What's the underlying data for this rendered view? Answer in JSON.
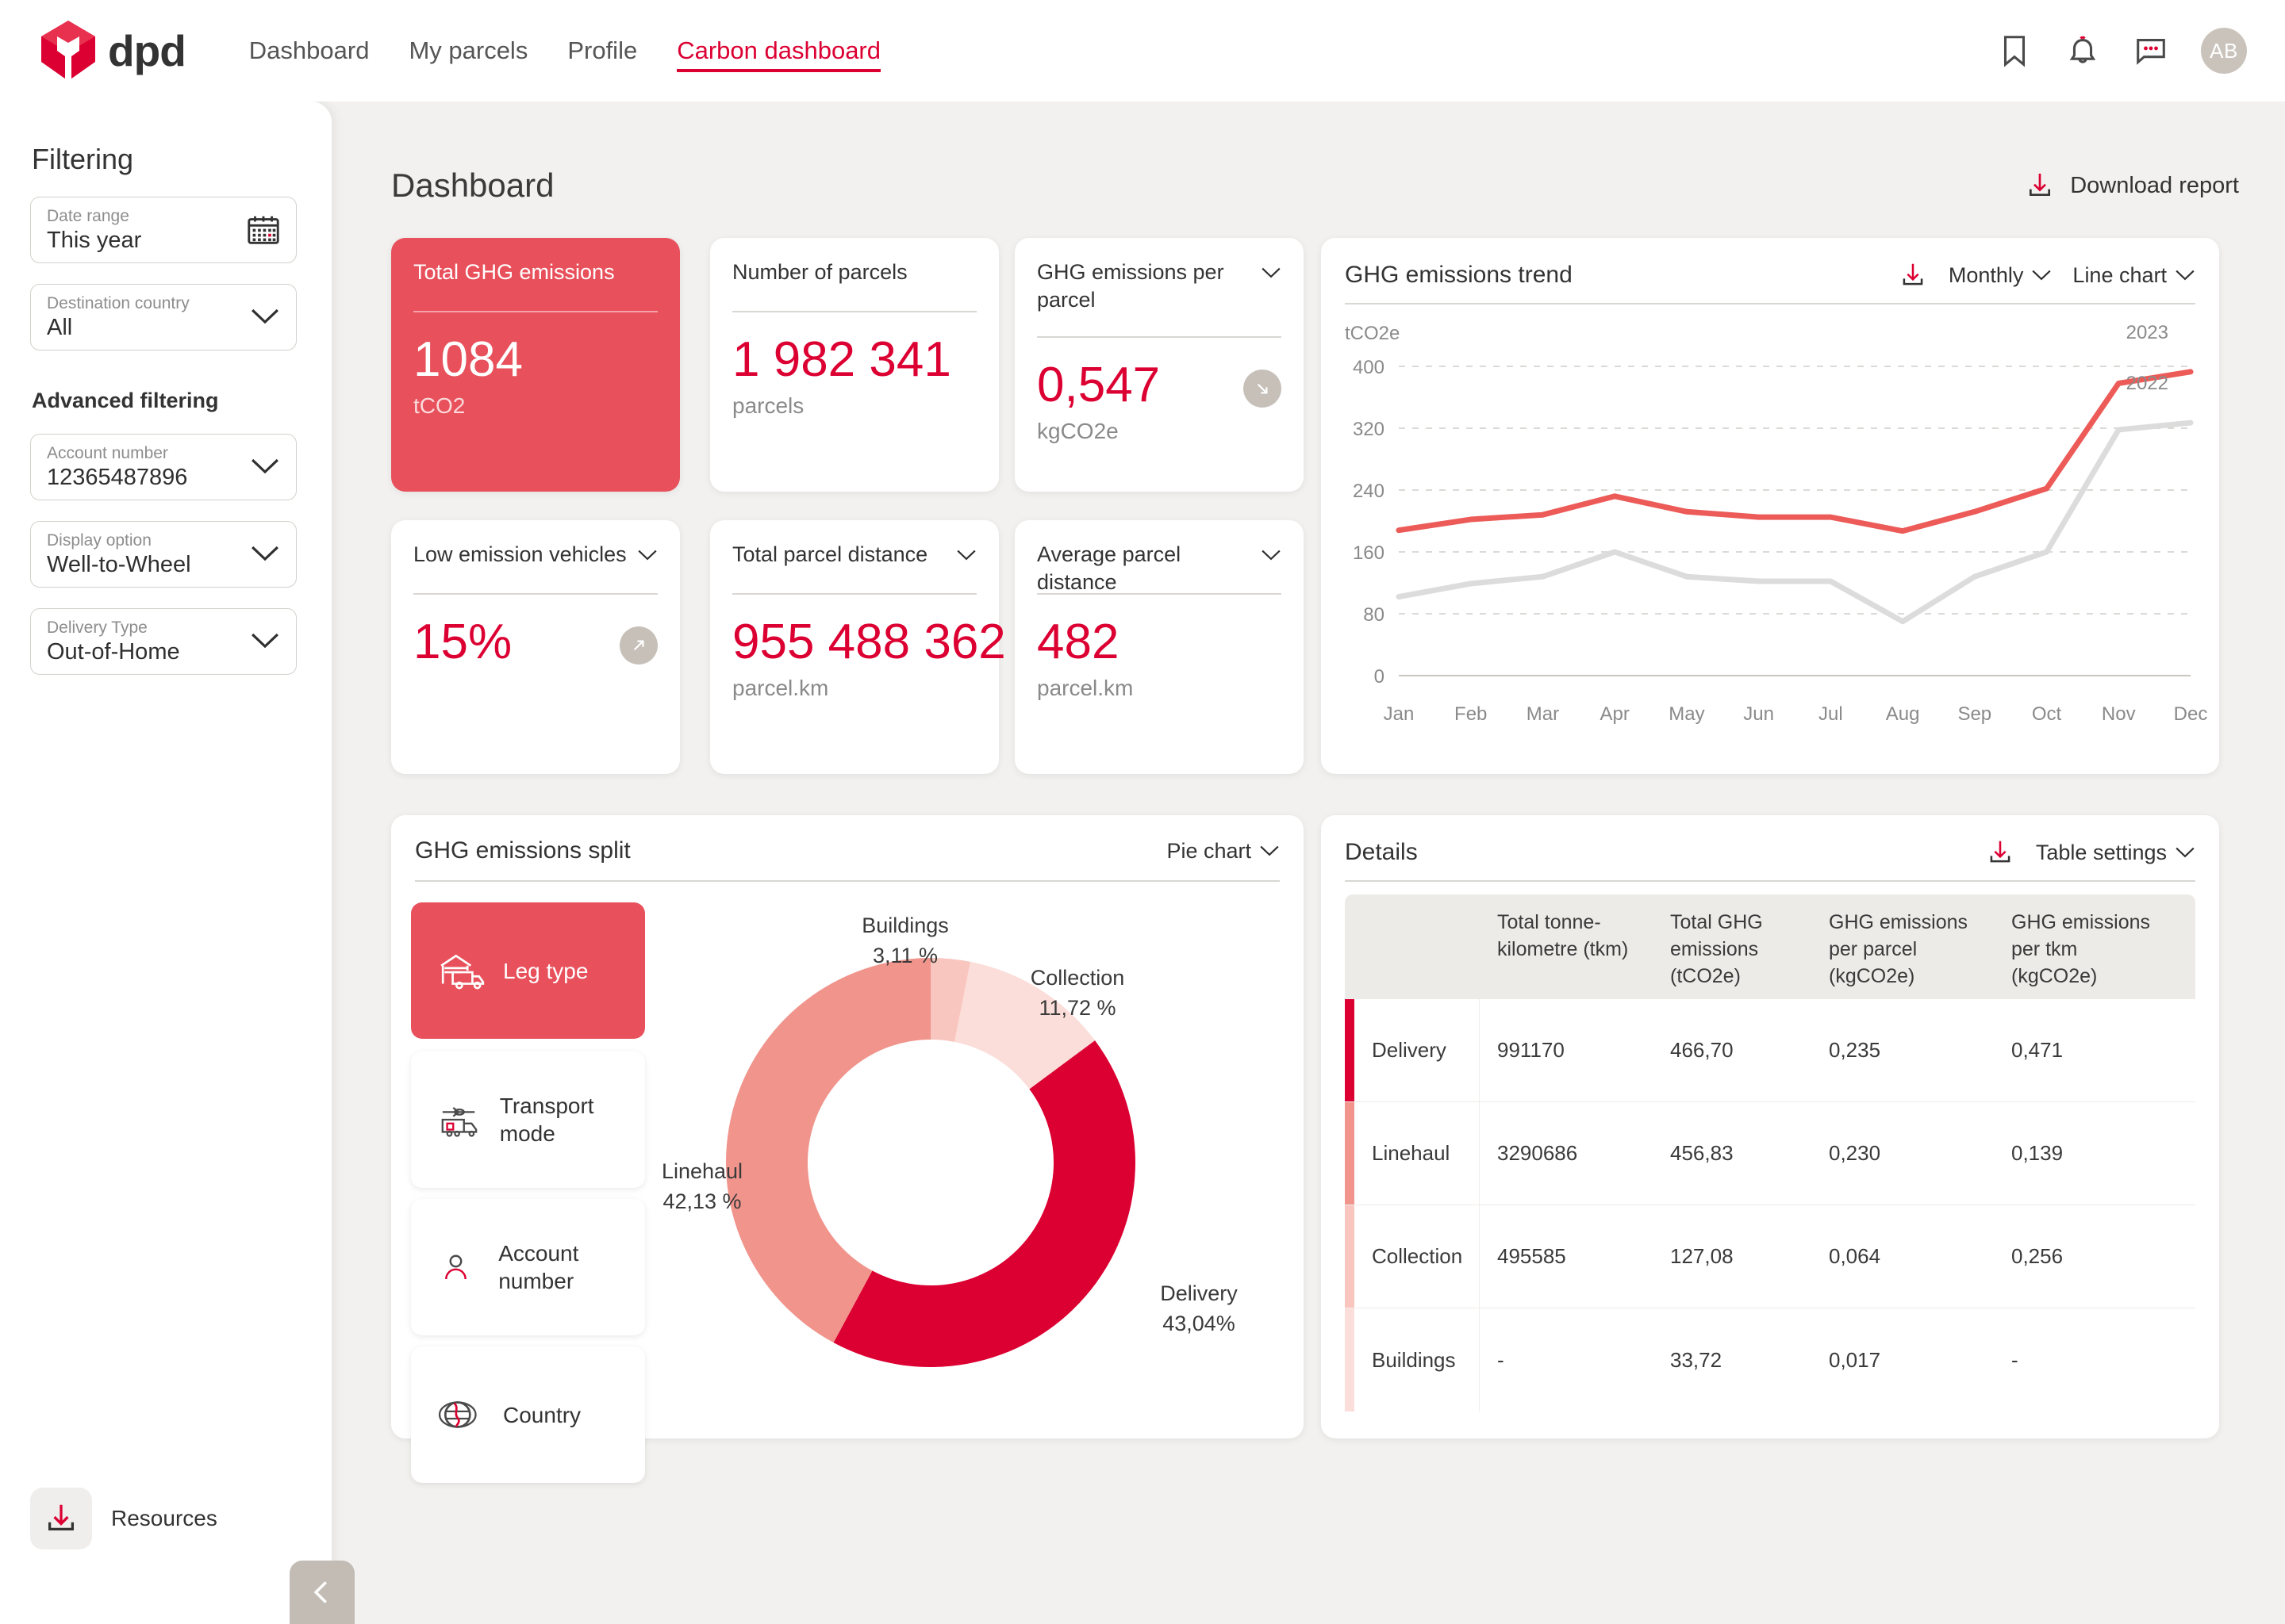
{
  "brand": {
    "name": "dpd",
    "red": "#DC0032",
    "card_red": "#E8505B",
    "salmon": "#F0948C",
    "pink_mid": "#F8C6BE",
    "pink_light": "#FBDDD9",
    "grey_line": "#DCDCDC"
  },
  "header": {
    "nav": [
      {
        "label": "Dashboard",
        "active": false
      },
      {
        "label": "My parcels",
        "active": false
      },
      {
        "label": "Profile",
        "active": false
      },
      {
        "label": "Carbon dashboard",
        "active": true
      }
    ],
    "icons": [
      "bookmark-icon",
      "bell-icon",
      "chat-icon"
    ],
    "avatar_initials": "AB"
  },
  "sidebar": {
    "title": "Filtering",
    "advanced_title": "Advanced filtering",
    "fields": [
      {
        "label": "Date range",
        "value": "This year",
        "control": "calendar-icon"
      },
      {
        "label": "Destination country",
        "value": "All",
        "control": "chevron-down-icon"
      }
    ],
    "advanced_fields": [
      {
        "label": "Account number",
        "value": "12365487896",
        "control": "chevron-down-icon"
      },
      {
        "label": "Display option",
        "value": "Well-to-Wheel",
        "control": "chevron-down-icon"
      },
      {
        "label": "Delivery Type",
        "value": "Out-of-Home",
        "control": "chevron-down-icon"
      }
    ],
    "resources_label": "Resources"
  },
  "main": {
    "page_title": "Dashboard",
    "download_report_label": "Download report"
  },
  "kpis": [
    {
      "title": "Total GHG emissions",
      "value": "1084",
      "unit": "tCO2",
      "highlight": true,
      "has_chevron": false,
      "badge": null
    },
    {
      "title": "Number of parcels",
      "value": "1 982 341",
      "unit": "parcels",
      "highlight": false,
      "has_chevron": false,
      "badge": null
    },
    {
      "title": "GHG emissions per parcel",
      "value": "0,547",
      "unit": "kgCO2e",
      "highlight": false,
      "has_chevron": true,
      "badge": "arrow-down-right-icon"
    },
    {
      "title": "Low emission vehicles",
      "value": "15%",
      "unit": "",
      "highlight": false,
      "has_chevron": true,
      "badge": "arrow-up-right-icon"
    },
    {
      "title": "Total parcel distance",
      "value": "955 488 362",
      "unit": "parcel.km",
      "highlight": false,
      "has_chevron": true,
      "badge": null
    },
    {
      "title": "Average parcel distance",
      "value": "482",
      "unit": "parcel.km",
      "highlight": false,
      "has_chevron": true,
      "badge": null
    }
  ],
  "trend_panel": {
    "title": "GHG emissions trend",
    "download_icon": "download-icon",
    "granularity": "Monthly",
    "chart_type": "Line chart"
  },
  "split_panel": {
    "title": "GHG emissions split",
    "chart_type": "Pie chart",
    "selectors": [
      {
        "label": "Leg type",
        "icon": "warehouse-truck-icon",
        "active": true
      },
      {
        "label": "Transport mode",
        "icon": "plane-truck-icon",
        "active": false
      },
      {
        "label": "Account number",
        "icon": "person-icon",
        "active": false
      },
      {
        "label": "Country",
        "icon": "globe-icon",
        "active": false
      }
    ]
  },
  "details_panel": {
    "title": "Details",
    "download_icon": "download-icon",
    "settings_label": "Table settings",
    "columns": [
      "",
      "Total tonne-kilometre (tkm)",
      "Total GHG emissions (tCO2e)",
      "GHG emissions per parcel (kgCO2e)",
      "GHG emissions per tkm (kgCO2e)"
    ],
    "rows": [
      {
        "name": "Delivery",
        "tkm": "991170",
        "tco2e": "466,70",
        "per_parcel": "0,235",
        "per_tkm": "0,471",
        "color": "#DC0032"
      },
      {
        "name": "Linehaul",
        "tkm": "3290686",
        "tco2e": "456,83",
        "per_parcel": "0,230",
        "per_tkm": "0,139",
        "color": "#F0948C"
      },
      {
        "name": "Collection",
        "tkm": "495585",
        "tco2e": "127,08",
        "per_parcel": "0,064",
        "per_tkm": "0,256",
        "color": "#F8C6BE"
      },
      {
        "name": "Buildings",
        "tkm": "-",
        "tco2e": "33,72",
        "per_parcel": "0,017",
        "per_tkm": "-",
        "color": "#FBDDD9"
      }
    ]
  },
  "chart_data": [
    {
      "type": "line",
      "title": "GHG emissions trend",
      "xlabel": "",
      "ylabel": "tCO2e",
      "ylim": [
        0,
        400
      ],
      "yticks": [
        0,
        80,
        160,
        240,
        320,
        400
      ],
      "grid": true,
      "legend_position": "inline-end-of-line",
      "categories": [
        "Jan",
        "Feb",
        "Mar",
        "Apr",
        "May",
        "Jun",
        "Jul",
        "Aug",
        "Sep",
        "Oct",
        "Nov",
        "Dec"
      ],
      "series": [
        {
          "name": "2023",
          "color": "#EC5B58",
          "values": [
            188,
            202,
            208,
            232,
            212,
            205,
            205,
            187,
            212,
            242,
            378,
            393
          ]
        },
        {
          "name": "2022",
          "color": "#DCDCDC",
          "values": [
            102,
            119,
            128,
            160,
            128,
            122,
            122,
            70,
            128,
            160,
            318,
            327
          ]
        }
      ]
    },
    {
      "type": "pie",
      "title": "GHG emissions split",
      "donut": true,
      "labels": [
        "Buildings",
        "Collection",
        "Delivery",
        "Linehaul"
      ],
      "values": [
        3.11,
        11.72,
        43.04,
        42.13
      ],
      "value_labels": [
        "3,11 %",
        "11,72 %",
        "43,04%",
        "42,13 %"
      ],
      "colors": [
        "#F8C6BE",
        "#FBDDD9",
        "#DC0032",
        "#F0948C"
      ]
    }
  ]
}
